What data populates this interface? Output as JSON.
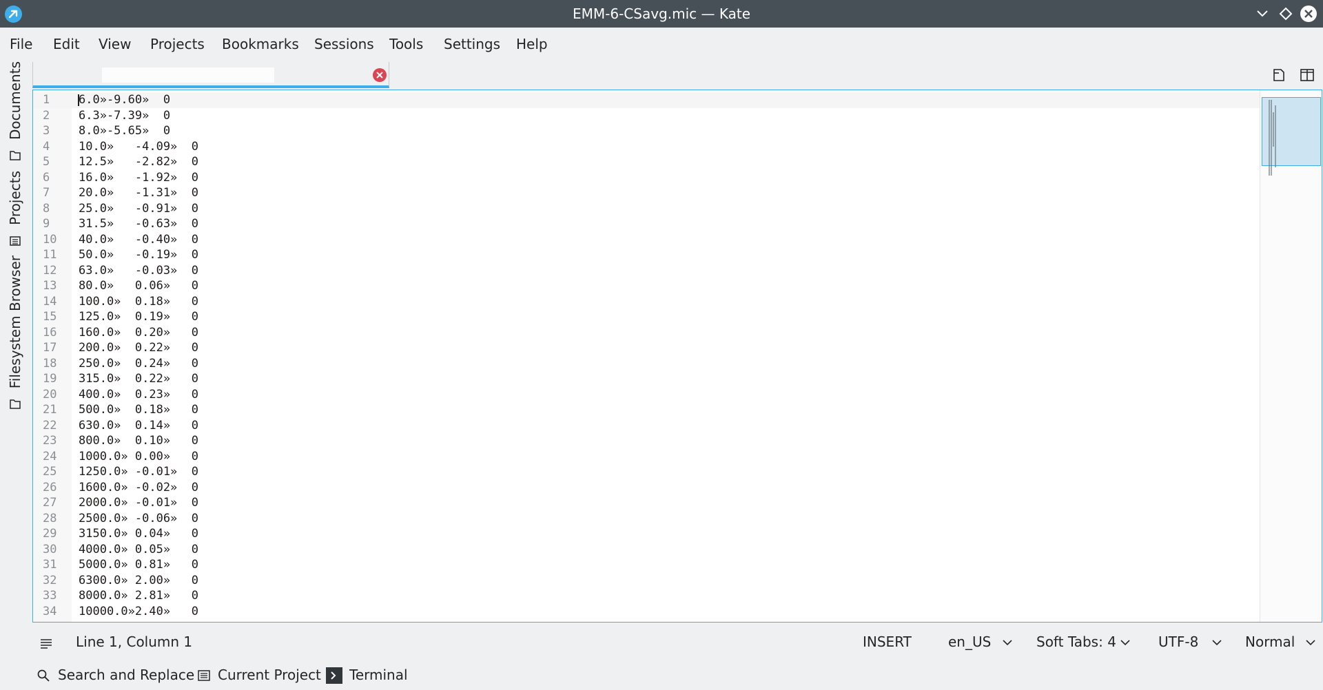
{
  "window": {
    "title": "EMM-6-CSavg.mic — Kate"
  },
  "menu": {
    "file": "File",
    "edit": "Edit",
    "view": "View",
    "projects": "Projects",
    "bookmarks": "Bookmarks",
    "sessions": "Sessions",
    "tools": "Tools",
    "settings": "Settings",
    "help": "Help"
  },
  "sidebar": {
    "documents": "Documents",
    "projects": "Projects",
    "filesystem": "Filesystem Browser"
  },
  "tabs": [
    {
      "label": ""
    }
  ],
  "editor": {
    "lines": [
      {
        "n": "1",
        "text": "6.0»-9.60»  0"
      },
      {
        "n": "2",
        "text": "6.3»-7.39»  0"
      },
      {
        "n": "3",
        "text": "8.0»-5.65»  0"
      },
      {
        "n": "4",
        "text": "10.0»   -4.09»  0"
      },
      {
        "n": "5",
        "text": "12.5»   -2.82»  0"
      },
      {
        "n": "6",
        "text": "16.0»   -1.92»  0"
      },
      {
        "n": "7",
        "text": "20.0»   -1.31»  0"
      },
      {
        "n": "8",
        "text": "25.0»   -0.91»  0"
      },
      {
        "n": "9",
        "text": "31.5»   -0.63»  0"
      },
      {
        "n": "10",
        "text": "40.0»   -0.40»  0"
      },
      {
        "n": "11",
        "text": "50.0»   -0.19»  0"
      },
      {
        "n": "12",
        "text": "63.0»   -0.03»  0"
      },
      {
        "n": "13",
        "text": "80.0»   0.06»   0"
      },
      {
        "n": "14",
        "text": "100.0»  0.18»   0"
      },
      {
        "n": "15",
        "text": "125.0»  0.19»   0"
      },
      {
        "n": "16",
        "text": "160.0»  0.20»   0"
      },
      {
        "n": "17",
        "text": "200.0»  0.22»   0"
      },
      {
        "n": "18",
        "text": "250.0»  0.24»   0"
      },
      {
        "n": "19",
        "text": "315.0»  0.22»   0"
      },
      {
        "n": "20",
        "text": "400.0»  0.23»   0"
      },
      {
        "n": "21",
        "text": "500.0»  0.18»   0"
      },
      {
        "n": "22",
        "text": "630.0»  0.14»   0"
      },
      {
        "n": "23",
        "text": "800.0»  0.10»   0"
      },
      {
        "n": "24",
        "text": "1000.0» 0.00»   0"
      },
      {
        "n": "25",
        "text": "1250.0» -0.01»  0"
      },
      {
        "n": "26",
        "text": "1600.0» -0.02»  0"
      },
      {
        "n": "27",
        "text": "2000.0» -0.01»  0"
      },
      {
        "n": "28",
        "text": "2500.0» -0.06»  0"
      },
      {
        "n": "29",
        "text": "3150.0» 0.04»   0"
      },
      {
        "n": "30",
        "text": "4000.0» 0.05»   0"
      },
      {
        "n": "31",
        "text": "5000.0» 0.81»   0"
      },
      {
        "n": "32",
        "text": "6300.0» 2.00»   0"
      },
      {
        "n": "33",
        "text": "8000.0» 2.81»   0"
      },
      {
        "n": "34",
        "text": "10000.0»2.40»   0"
      }
    ]
  },
  "status": {
    "position": "Line 1, Column 1",
    "mode": "INSERT",
    "language": "en_US",
    "indent": "Soft Tabs: 4",
    "encoding": "UTF-8",
    "input_mode": "Normal"
  },
  "toolviews": {
    "search": "Search and Replace",
    "project": "Current Project",
    "terminal": "Terminal"
  },
  "colors": {
    "accent": "#3daee9",
    "titlebar": "#475057",
    "close": "#da4453"
  }
}
